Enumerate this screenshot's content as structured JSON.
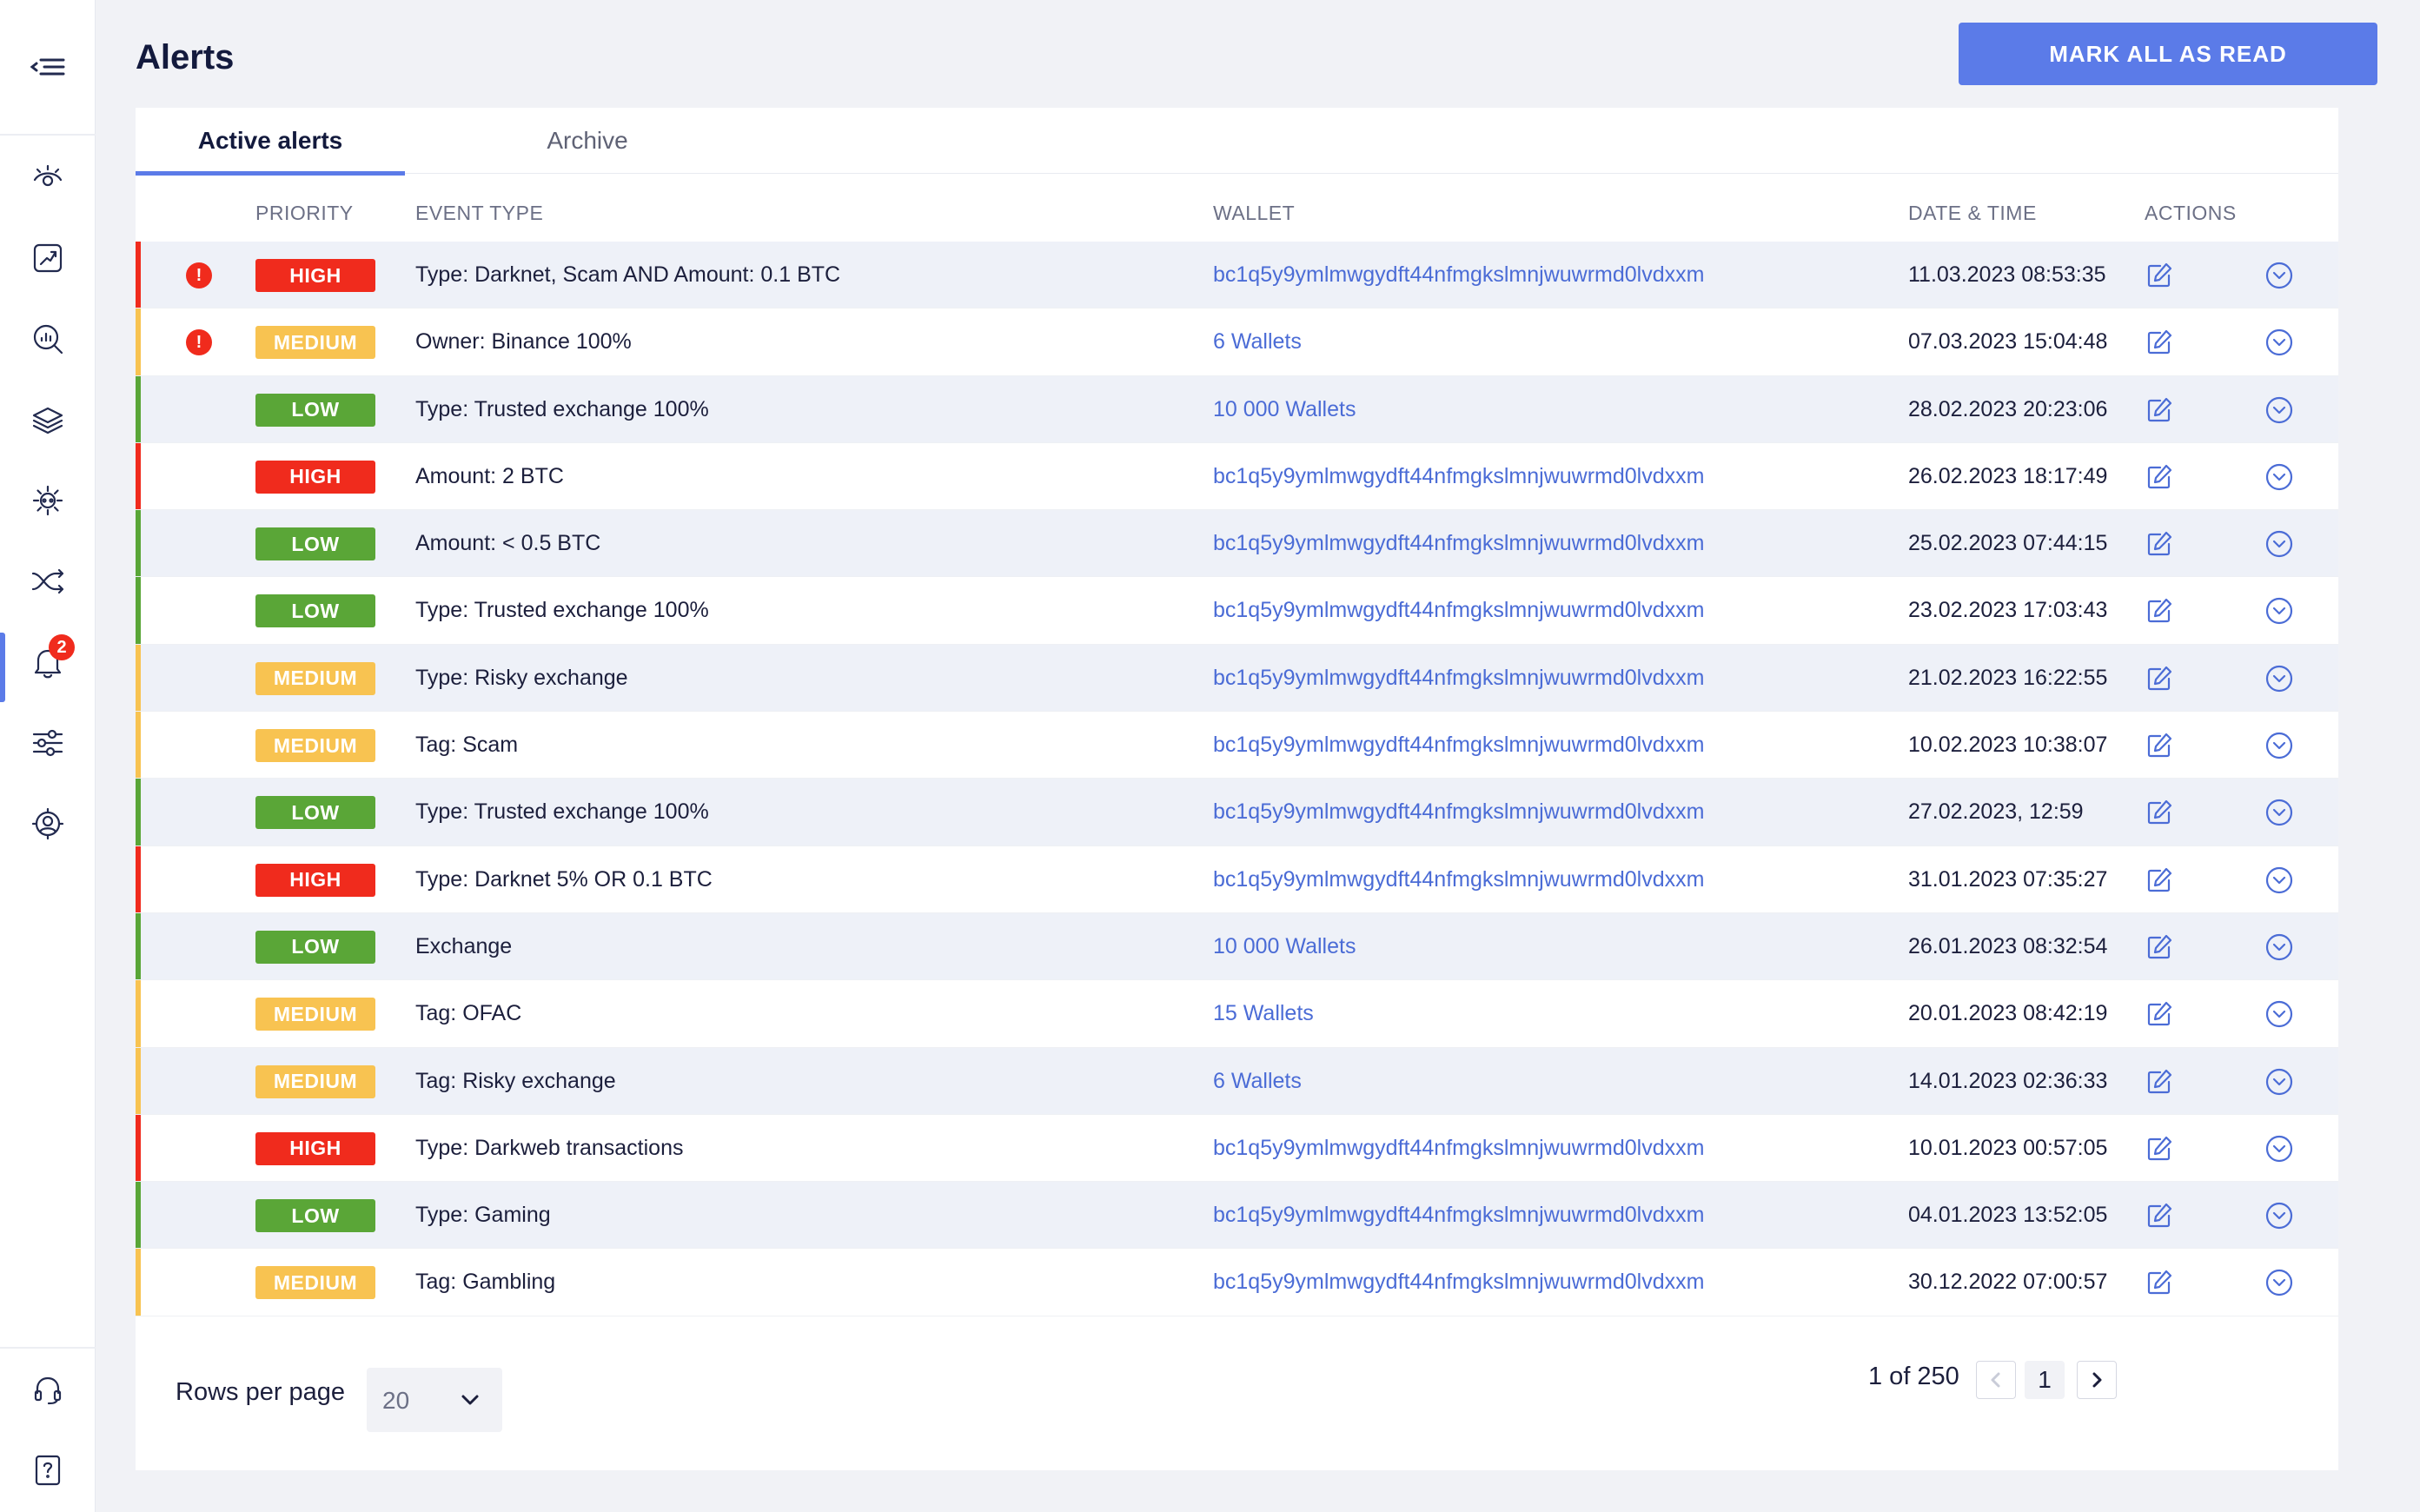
{
  "header": {
    "title": "Alerts",
    "mark_all_label": "MARK ALL AS READ"
  },
  "sidebar": {
    "items": [
      {
        "icon": "eye-icon"
      },
      {
        "icon": "trend-chart-icon"
      },
      {
        "icon": "search-analytics-icon"
      },
      {
        "icon": "layers-icon"
      },
      {
        "icon": "cog-network-icon"
      },
      {
        "icon": "split-arrows-icon"
      },
      {
        "icon": "bell-icon",
        "active": true,
        "badge": "2"
      },
      {
        "icon": "sliders-icon"
      },
      {
        "icon": "user-settings-icon"
      }
    ],
    "bottom": [
      {
        "icon": "headset-icon"
      },
      {
        "icon": "help-icon"
      }
    ]
  },
  "tabs": [
    {
      "label": "Active alerts",
      "active": true
    },
    {
      "label": "Archive",
      "active": false
    }
  ],
  "table": {
    "columns": {
      "priority": "PRIORITY",
      "event_type": "EVENT TYPE",
      "wallet": "WALLET",
      "datetime": "DATE & TIME",
      "actions": "ACTIONS"
    },
    "priority_colors": {
      "HIGH": "#f02b1d",
      "MEDIUM": "#f8c351",
      "LOW": "#5aa637"
    },
    "rows": [
      {
        "unread": true,
        "priority": "HIGH",
        "event": "Type: Darknet, Scam AND Amount: 0.1 BTC",
        "wallet": "bc1q5y9ymlmwgydft44nfmgkslmnjwuwrmd0lvdxxm",
        "datetime": "11.03.2023 08:53:35"
      },
      {
        "unread": true,
        "priority": "MEDIUM",
        "event": "Owner: Binance 100%",
        "wallet": "6 Wallets",
        "datetime": "07.03.2023 15:04:48"
      },
      {
        "unread": false,
        "priority": "LOW",
        "event": "Type: Trusted exchange 100%",
        "wallet": "10 000 Wallets",
        "datetime": "28.02.2023 20:23:06"
      },
      {
        "unread": false,
        "priority": "HIGH",
        "event": "Amount: 2 BTC",
        "wallet": "bc1q5y9ymlmwgydft44nfmgkslmnjwuwrmd0lvdxxm",
        "datetime": "26.02.2023 18:17:49"
      },
      {
        "unread": false,
        "priority": "LOW",
        "event": "Amount: < 0.5 BTC",
        "wallet": "bc1q5y9ymlmwgydft44nfmgkslmnjwuwrmd0lvdxxm",
        "datetime": "25.02.2023 07:44:15"
      },
      {
        "unread": false,
        "priority": "LOW",
        "event": "Type: Trusted exchange 100%",
        "wallet": "bc1q5y9ymlmwgydft44nfmgkslmnjwuwrmd0lvdxxm",
        "datetime": "23.02.2023 17:03:43"
      },
      {
        "unread": false,
        "priority": "MEDIUM",
        "event": "Type: Risky exchange",
        "wallet": "bc1q5y9ymlmwgydft44nfmgkslmnjwuwrmd0lvdxxm",
        "datetime": "21.02.2023 16:22:55"
      },
      {
        "unread": false,
        "priority": "MEDIUM",
        "event": "Tag: Scam",
        "wallet": "bc1q5y9ymlmwgydft44nfmgkslmnjwuwrmd0lvdxxm",
        "datetime": "10.02.2023 10:38:07"
      },
      {
        "unread": false,
        "priority": "LOW",
        "event": "Type: Trusted exchange 100%",
        "wallet": "bc1q5y9ymlmwgydft44nfmgkslmnjwuwrmd0lvdxxm",
        "datetime": "27.02.2023, 12:59"
      },
      {
        "unread": false,
        "priority": "HIGH",
        "event": "Type: Darknet 5% OR 0.1 BTC",
        "wallet": "bc1q5y9ymlmwgydft44nfmgkslmnjwuwrmd0lvdxxm",
        "datetime": "31.01.2023 07:35:27"
      },
      {
        "unread": false,
        "priority": "LOW",
        "event": "Exchange",
        "wallet": "10 000 Wallets",
        "datetime": "26.01.2023 08:32:54"
      },
      {
        "unread": false,
        "priority": "MEDIUM",
        "event": "Tag: OFAC",
        "wallet": "15 Wallets",
        "datetime": "20.01.2023 08:42:19"
      },
      {
        "unread": false,
        "priority": "MEDIUM",
        "event": "Tag: Risky exchange",
        "wallet": "6 Wallets",
        "datetime": "14.01.2023 02:36:33"
      },
      {
        "unread": false,
        "priority": "HIGH",
        "event": "Type: Darkweb transactions",
        "wallet": "bc1q5y9ymlmwgydft44nfmgkslmnjwuwrmd0lvdxxm",
        "datetime": "10.01.2023 00:57:05"
      },
      {
        "unread": false,
        "priority": "LOW",
        "event": "Type: Gaming",
        "wallet": "bc1q5y9ymlmwgydft44nfmgkslmnjwuwrmd0lvdxxm",
        "datetime": "04.01.2023 13:52:05"
      },
      {
        "unread": false,
        "priority": "MEDIUM",
        "event": "Tag: Gambling",
        "wallet": "bc1q5y9ymlmwgydft44nfmgkslmnjwuwrmd0lvdxxm",
        "datetime": "30.12.2022 07:00:57"
      }
    ]
  },
  "footer": {
    "rows_per_page_label": "Rows per page",
    "rows_per_page_value": "20",
    "page_info": "1 of 250",
    "current_page": "1"
  }
}
